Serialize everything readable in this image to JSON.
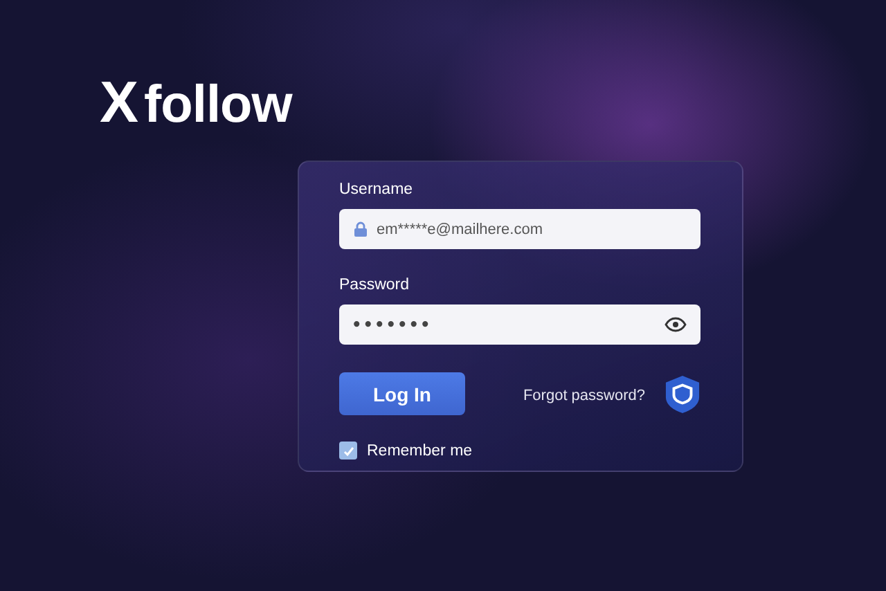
{
  "logo": {
    "mark": "X",
    "name": "follow"
  },
  "login": {
    "username": {
      "label": "Username",
      "value": "em*****e@mailhere.com"
    },
    "password": {
      "label": "Password",
      "value": "•••••••"
    },
    "login_button": "Log In",
    "forgot_link": "Forgot password?",
    "remember": {
      "label": "Remember me",
      "checked": true
    }
  }
}
